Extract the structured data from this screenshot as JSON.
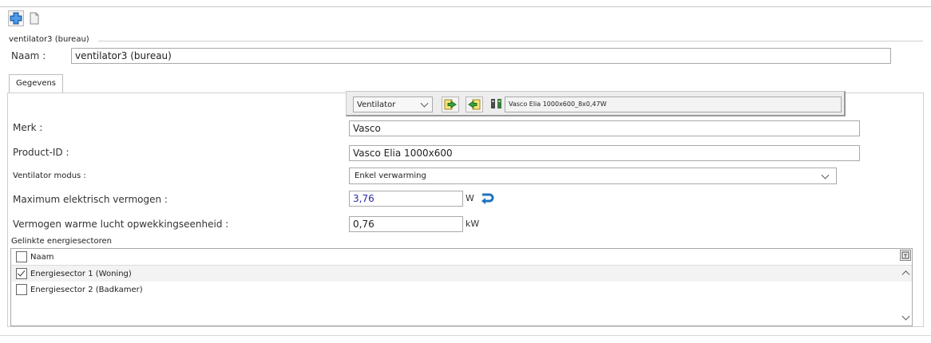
{
  "toolbar": {
    "add_icon": "plus-icon",
    "copy_icon": "document-icon"
  },
  "group_title": "ventilator3 (bureau)",
  "naam": {
    "label": "Naam :",
    "value": "ventilator3 (bureau)"
  },
  "tabs": [
    {
      "label": "Gegevens"
    }
  ],
  "product_selector": {
    "type": "Ventilator",
    "product": "Vasco Elia 1000x600_8x0,47W"
  },
  "fields": {
    "merk": {
      "label": "Merk :",
      "value": "Vasco"
    },
    "product_id": {
      "label": "Product-ID :",
      "value": "Vasco Elia 1000x600"
    },
    "modus": {
      "label": "Ventilator modus :",
      "value": "Enkel verwarming"
    },
    "max_vermogen": {
      "label": "Maximum elektrisch vermogen :",
      "value": "3,76",
      "unit": "W"
    },
    "warme_lucht": {
      "label": "Vermogen warme lucht opwekkingseenheid :",
      "value": "0,76",
      "unit": "kW"
    }
  },
  "sectors": {
    "title": "Gelinkte energiesectoren",
    "header": "Naam",
    "items": [
      {
        "label": "Energiesector 1 (Woning)",
        "checked": true
      },
      {
        "label": "Energiesector 2 (Badkamer)",
        "checked": false
      }
    ]
  },
  "colors": {
    "blue_value": "#2a2aa8",
    "accent_blue": "#1e73be"
  }
}
